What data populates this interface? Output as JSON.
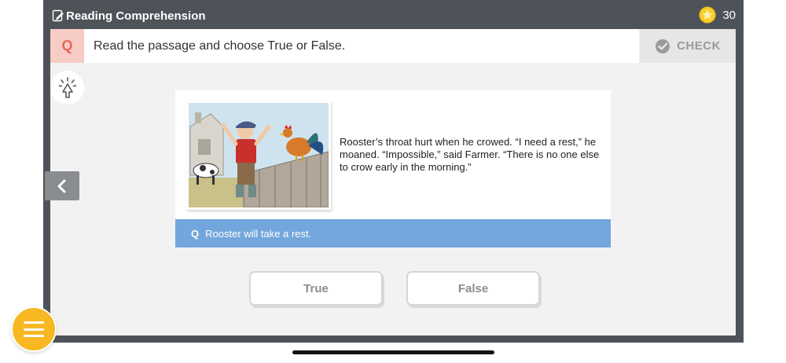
{
  "header": {
    "title": "Reading Comprehension",
    "star_count": "30",
    "title_icon": "edit-document-icon",
    "star_icon": "star-coin-icon"
  },
  "question": {
    "badge": "Q",
    "instruction": "Read the passage and choose True or False.",
    "check_label": "CHECK"
  },
  "passage": {
    "text": "Rooster’s throat hurt when he crowed. “I need a rest,” he moaned. “Impossible,” said Farmer. “There is no one else to crow early in the morning.”",
    "illustration": "farmer-and-rooster-illustration"
  },
  "statement": {
    "badge": "Q",
    "text": "Rooster will take a rest."
  },
  "answers": {
    "true_label": "True",
    "false_label": "False"
  },
  "colors": {
    "frame": "#4d5359",
    "q_badge_bg": "#f7ccc4",
    "q_badge_text": "#e5665a",
    "statement_strip": "#73a6dc",
    "menu": "#f7b824",
    "star": "#f5c518"
  }
}
